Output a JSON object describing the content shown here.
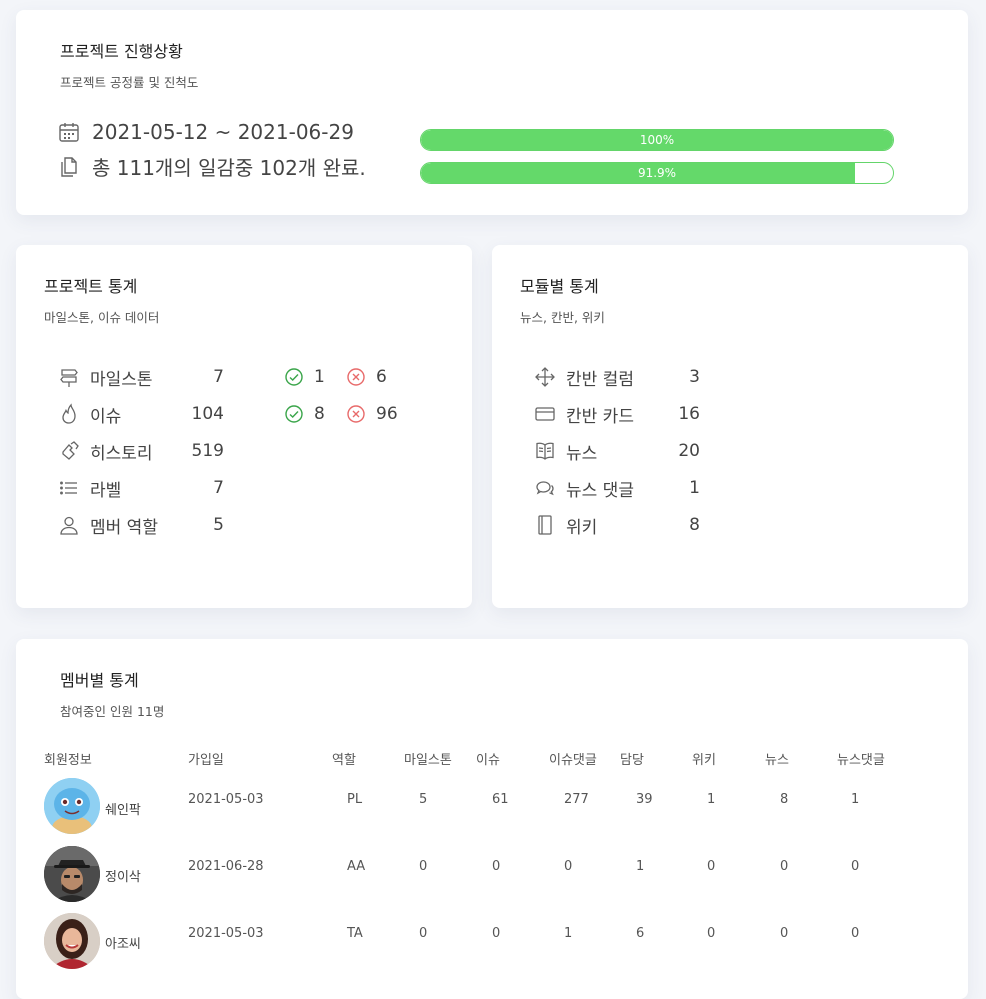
{
  "progress": {
    "title": "프로젝트 진행상황",
    "subtitle": "프로젝트 공정률 및 진척도",
    "date_range": "2021-05-12 ~ 2021-06-29",
    "summary": "총 111개의 일감중 102개 완료.",
    "bars": [
      {
        "label": "100%",
        "value": 100
      },
      {
        "label": "91.9%",
        "value": 91.9
      }
    ],
    "color": "#64d96a"
  },
  "project_stats": {
    "title": "프로젝트 통계",
    "subtitle": "마일스톤, 이슈 데이터",
    "rows": [
      {
        "icon": "signpost-icon",
        "label": "마일스톤",
        "value": "7"
      },
      {
        "icon": "fire-icon",
        "label": "이슈",
        "value": "104"
      },
      {
        "icon": "history-icon",
        "label": "히스토리",
        "value": "519"
      },
      {
        "icon": "list-icon",
        "label": "라벨",
        "value": "7"
      },
      {
        "icon": "user-icon",
        "label": "멤버 역할",
        "value": "5"
      }
    ],
    "milestone_status": {
      "open": "1",
      "closed": "6"
    },
    "issue_status": {
      "open": "8",
      "closed": "96"
    }
  },
  "module_stats": {
    "title": "모듈별 통계",
    "subtitle": "뉴스, 칸반, 위키",
    "rows": [
      {
        "icon": "move-icon",
        "label": "칸반 컬럼",
        "value": "3"
      },
      {
        "icon": "card-icon",
        "label": "칸반 카드",
        "value": "16"
      },
      {
        "icon": "book-icon",
        "label": "뉴스",
        "value": "20"
      },
      {
        "icon": "comments-icon",
        "label": "뉴스 댓글",
        "value": "1"
      },
      {
        "icon": "notebook-icon",
        "label": "위키",
        "value": "8"
      }
    ]
  },
  "members": {
    "title": "멤버별 통계",
    "subtitle": "참여중인 인원 11명",
    "headers": [
      "회원정보",
      "가입일",
      "역할",
      "마일스톤",
      "이슈",
      "이슈댓글",
      "담당",
      "위키",
      "뉴스",
      "뉴스댓글"
    ],
    "rows": [
      {
        "name": "쉐인팍",
        "joined": "2021-05-03",
        "role": "PL",
        "milestone": "5",
        "issue": "61",
        "issue_comment": "277",
        "assigned": "39",
        "wiki": "1",
        "news": "8",
        "news_comment": "1",
        "avatar": "turtle-avatar"
      },
      {
        "name": "정이삭",
        "joined": "2021-06-28",
        "role": "AA",
        "milestone": "0",
        "issue": "0",
        "issue_comment": "0",
        "assigned": "1",
        "wiki": "0",
        "news": "0",
        "news_comment": "0",
        "avatar": "man-hat-avatar"
      },
      {
        "name": "아조씨",
        "joined": "2021-05-03",
        "role": "TA",
        "milestone": "0",
        "issue": "0",
        "issue_comment": "1",
        "assigned": "6",
        "wiki": "0",
        "news": "0",
        "news_comment": "0",
        "avatar": "woman-avatar"
      }
    ]
  }
}
